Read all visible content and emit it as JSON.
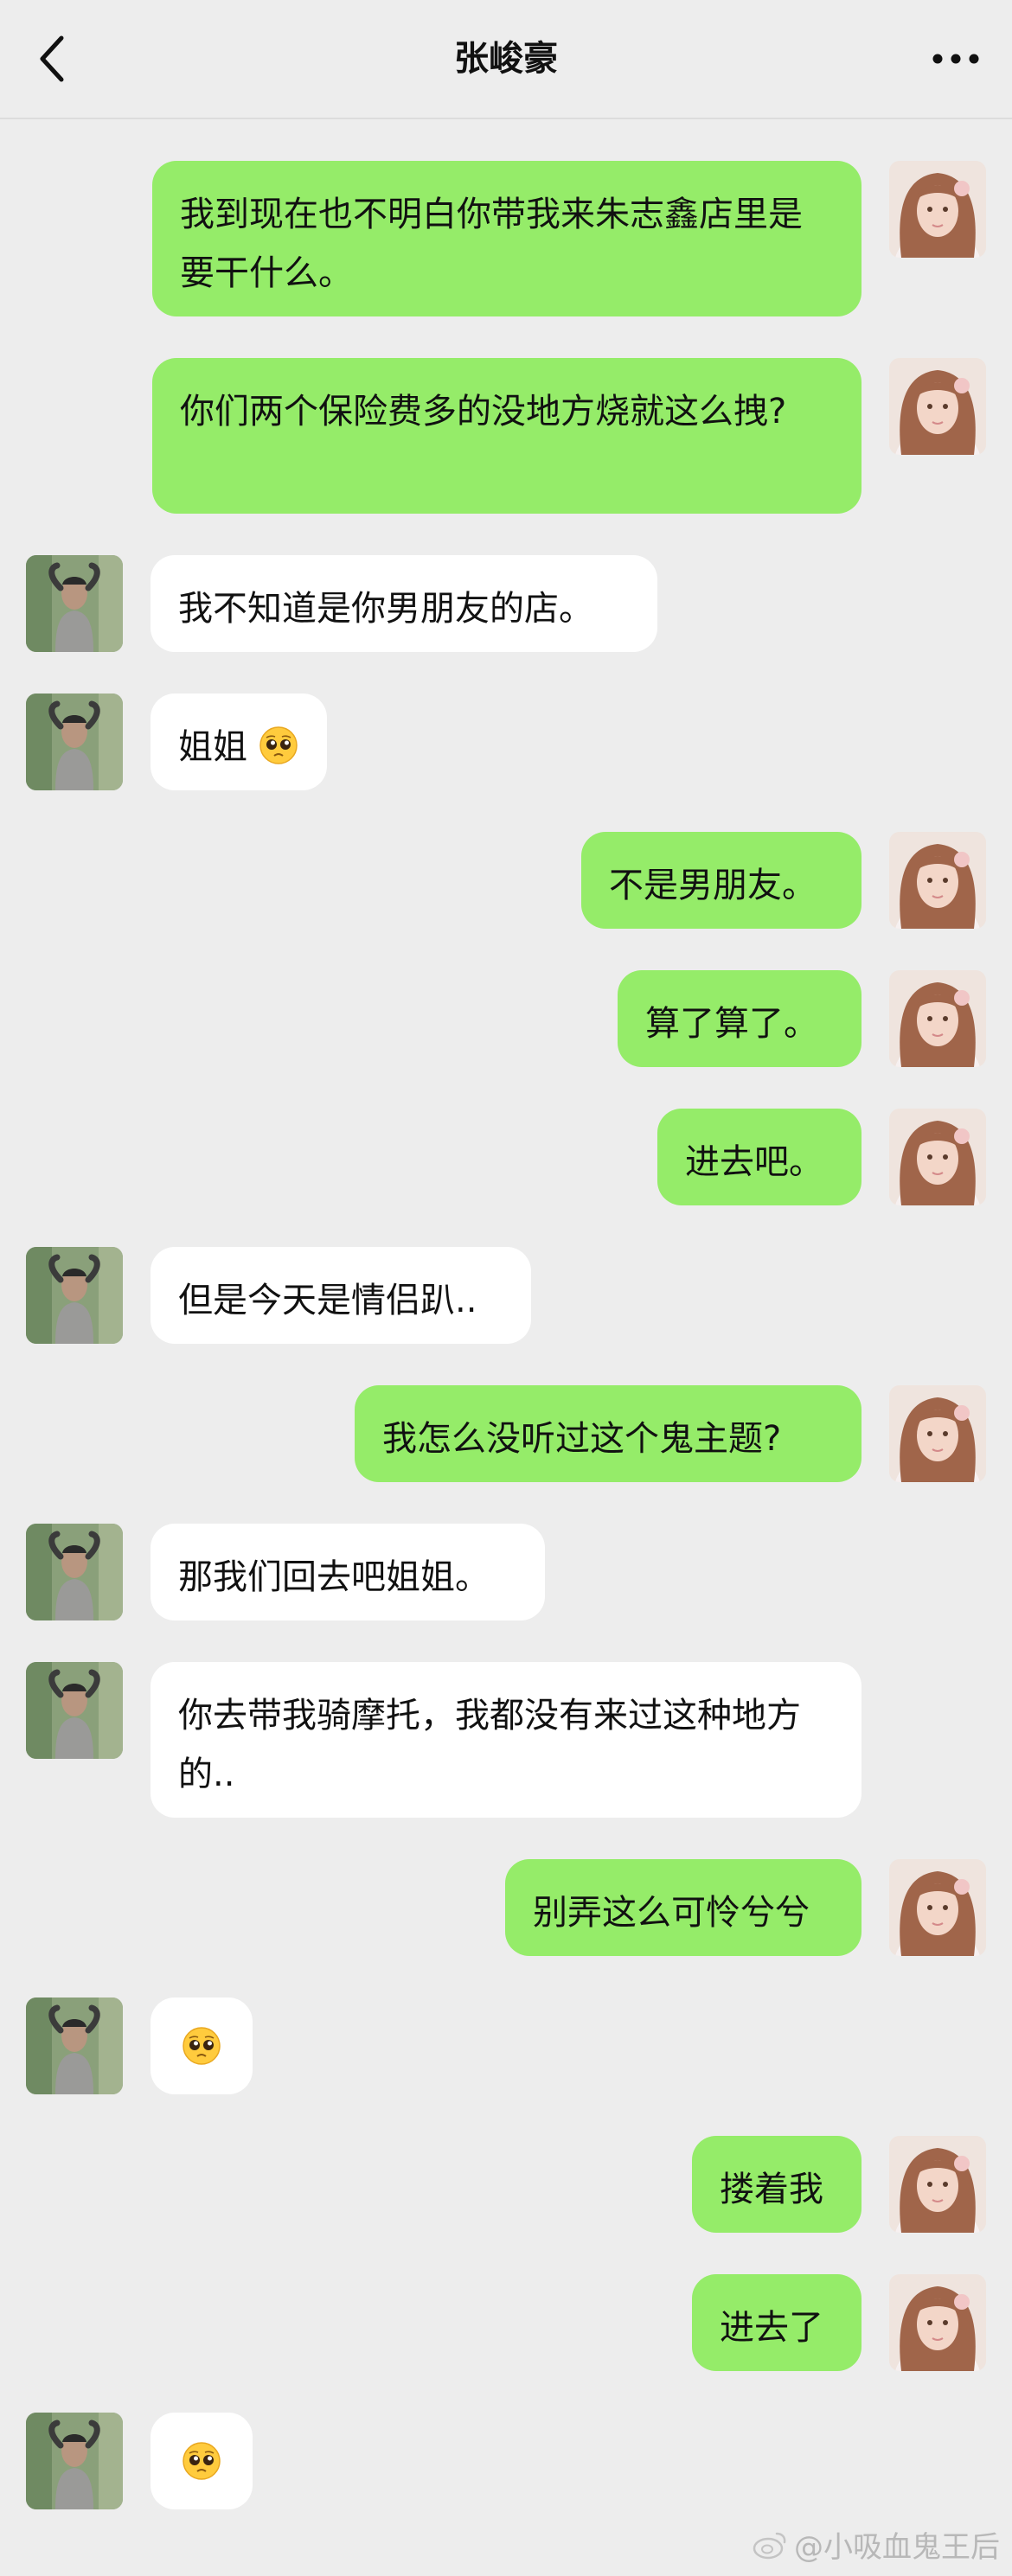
{
  "header": {
    "title": "张峻豪",
    "back_icon": "chevron-left-icon",
    "more_icon": "more-dots-icon"
  },
  "colors": {
    "background": "#ededed",
    "sent_bubble": "#95ec69",
    "received_bubble": "#ffffff"
  },
  "messages": [
    {
      "side": "sent",
      "text": "我到现在也不明白你带我来朱志鑫店里是要干什么。"
    },
    {
      "side": "sent",
      "text": "你们两个保险费多的没地方烧就这么拽?"
    },
    {
      "side": "received",
      "text": "我不知道是你男朋友的店。"
    },
    {
      "side": "received",
      "text": "姐姐",
      "emoji": "pleading-face-icon"
    },
    {
      "side": "sent",
      "text": "不是男朋友。"
    },
    {
      "side": "sent",
      "text": "算了算了。"
    },
    {
      "side": "sent",
      "text": "进去吧。"
    },
    {
      "side": "received",
      "text": "但是今天是情侣趴.."
    },
    {
      "side": "sent",
      "text": "我怎么没听过这个鬼主题?"
    },
    {
      "side": "received",
      "text": "那我们回去吧姐姐。"
    },
    {
      "side": "received",
      "text": "你去带我骑摩托，我都没有来过这种地方的.."
    },
    {
      "side": "sent",
      "text": "别弄这么可怜兮兮"
    },
    {
      "side": "received",
      "text": "",
      "emoji": "pleading-face-icon"
    },
    {
      "side": "sent",
      "text": "搂着我"
    },
    {
      "side": "sent",
      "text": "进去了"
    },
    {
      "side": "received",
      "text": "",
      "emoji": "pleading-face-icon"
    }
  ],
  "watermark": {
    "icon": "weibo-icon",
    "text": "@小吸血鬼王后"
  }
}
